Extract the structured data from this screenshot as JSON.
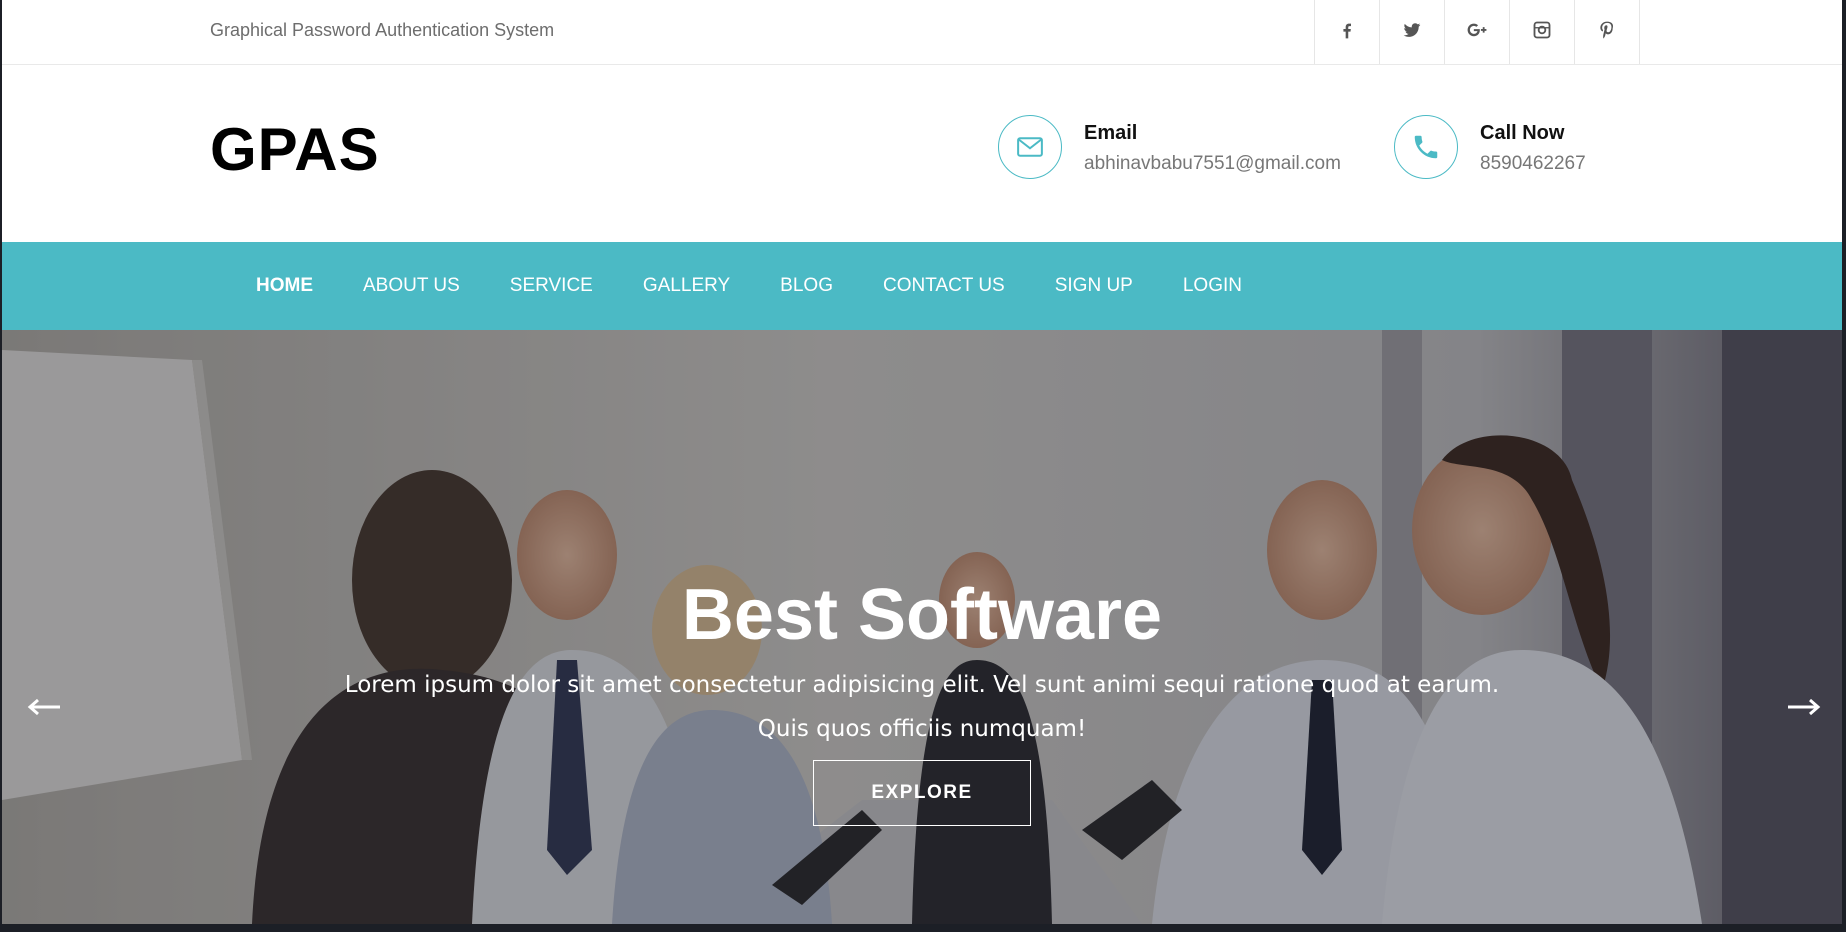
{
  "topbar": {
    "tagline": "Graphical Password Authentication System",
    "socials": [
      {
        "name": "facebook-icon"
      },
      {
        "name": "twitter-icon"
      },
      {
        "name": "google-plus-icon"
      },
      {
        "name": "instagram-icon"
      },
      {
        "name": "pinterest-icon"
      }
    ]
  },
  "header": {
    "logo": "GPAS",
    "email": {
      "label": "Email",
      "value": "abhinavbabu7551@gmail.com",
      "icon": "envelope-icon"
    },
    "phone": {
      "label": "Call Now",
      "value": "8590462267",
      "icon": "phone-icon"
    }
  },
  "nav": {
    "items": [
      {
        "label": "HOME",
        "active": true
      },
      {
        "label": "ABOUT US"
      },
      {
        "label": "SERVICE"
      },
      {
        "label": "GALLERY"
      },
      {
        "label": "BLOG"
      },
      {
        "label": "CONTACT US"
      },
      {
        "label": "SIGN UP"
      },
      {
        "label": "LOGIN"
      }
    ]
  },
  "hero": {
    "title": "Best Software",
    "text_line1": "Lorem ipsum dolor sit amet consectetur adipisicing elit. Vel sunt animi sequi ratione quod at earum.",
    "text_line2": "Quis quos officiis numquam!",
    "button_label": "EXPLORE",
    "prev_icon": "arrow-left-icon",
    "next_icon": "arrow-right-icon"
  },
  "colors": {
    "accent": "#4bbac5",
    "text_dark": "#000000",
    "text_muted": "#777777"
  }
}
